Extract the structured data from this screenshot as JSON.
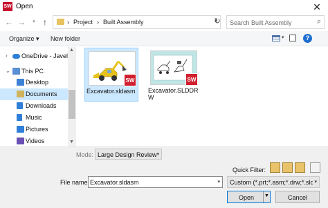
{
  "window": {
    "title": "Open",
    "app_icon": "solidworks-icon"
  },
  "nav": {
    "breadcrumbs": [
      "Project",
      "Built Assembly"
    ],
    "search_placeholder": "Search Built Assembly"
  },
  "toolbar": {
    "organize_label": "Organize",
    "new_folder_label": "New folder"
  },
  "sidebar": {
    "items": [
      {
        "label": "OneDrive - Javelin",
        "icon": "cloud-icon",
        "color": "#2f7fd8"
      },
      {
        "label": "This PC",
        "icon": "computer-icon",
        "color": "#5b8fd4"
      },
      {
        "label": "Desktop",
        "icon": "desktop-icon",
        "color": "#3b82d6"
      },
      {
        "label": "Documents",
        "icon": "documents-icon",
        "color": "#d0b35c",
        "selected": true
      },
      {
        "label": "Downloads",
        "icon": "downloads-icon",
        "color": "#2f7fd8"
      },
      {
        "label": "Music",
        "icon": "music-icon",
        "color": "#2f7fd8"
      },
      {
        "label": "Pictures",
        "icon": "pictures-icon",
        "color": "#2f7fd8"
      },
      {
        "label": "Videos",
        "icon": "videos-icon",
        "color": "#6a4fb5"
      }
    ]
  },
  "files": [
    {
      "name": "Excavator.sldasm",
      "type": "assembly",
      "selected": true
    },
    {
      "name": "Excavator.SLDDRW",
      "type": "drawing",
      "selected": false
    }
  ],
  "bottom": {
    "mode_label": "Mode:",
    "mode_value": "Large Design Review",
    "quick_filter_label": "Quick Filter:",
    "file_name_label": "File name:",
    "file_name_value": "Excavator.sldasm",
    "file_type_value": "Custom (*.prt;*.asm;*.drw;*.sldpr",
    "open_label": "Open",
    "cancel_label": "Cancel"
  },
  "colors": {
    "accent": "#0078d7",
    "selection": "#cce8ff",
    "sw_red": "#d11f2f"
  }
}
